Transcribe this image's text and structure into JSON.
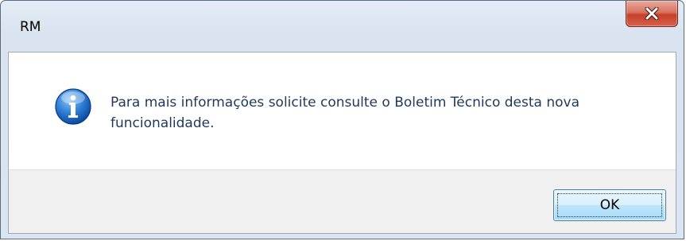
{
  "window": {
    "title": "RM",
    "close_icon": "close-icon"
  },
  "dialog": {
    "icon": "information-icon",
    "message": "Para mais informações solicite consulte o Boletim Técnico desta nova funcionalidade.",
    "ok_label": "OK"
  },
  "colors": {
    "message_text": "#1e395b",
    "close_button": "#c5402a",
    "ok_button_border": "#3c7fb1"
  }
}
